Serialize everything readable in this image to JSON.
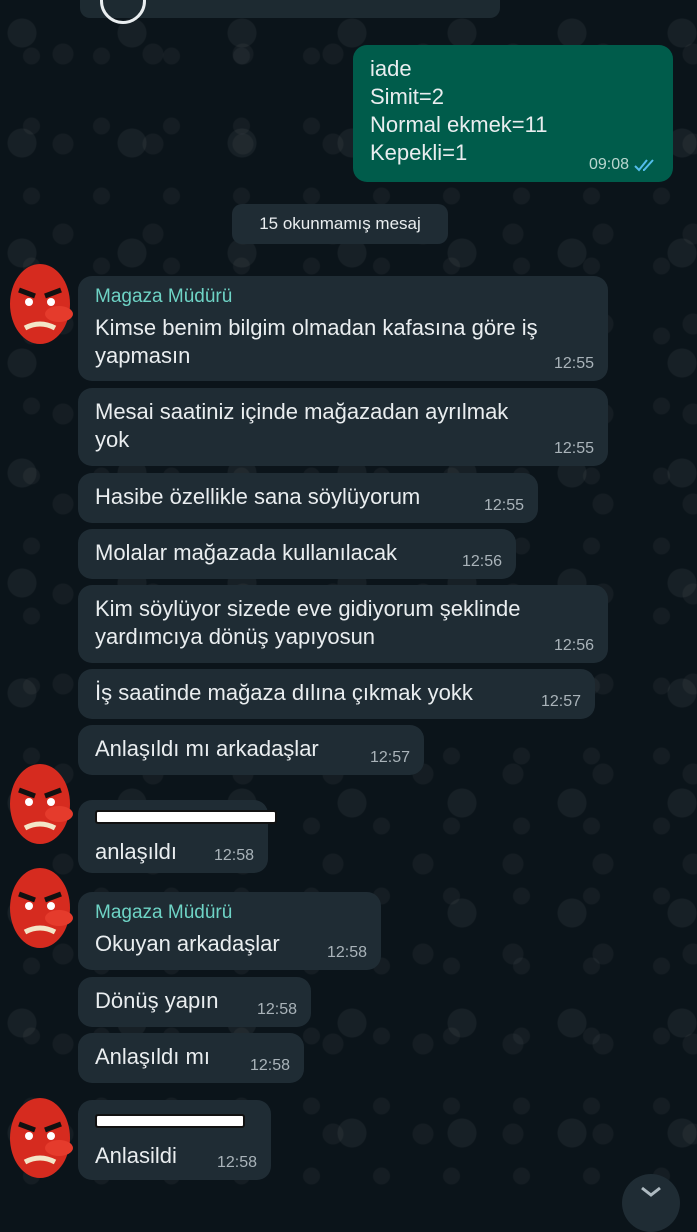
{
  "outgoing": {
    "text": "iade\nSimit=2\nNormal ekmek=11\nKepekli=1",
    "time": "09:08"
  },
  "unread_divider": "15 okunmamış mesaj",
  "sender_name": "Magaza Müdürü",
  "messages": [
    {
      "text": "Kimse benim bilgim olmadan kafasına göre iş\nyapmasın",
      "time": "12:55"
    },
    {
      "text": "Mesai saatiniz içinde mağazadan ayrılmak\nyok",
      "time": "12:55"
    },
    {
      "text": "Hasibe özellikle sana söylüyorum",
      "time": "12:55"
    },
    {
      "text": "Molalar mağazada kullanılacak",
      "time": "12:56"
    },
    {
      "text": "Kim söylüyor sizede eve gidiyorum şeklinde\nyardımcıya dönüş yapıyosun",
      "time": "12:56"
    },
    {
      "text": "İş saatinde mağaza dılına çıkmak yokk",
      "time": "12:57"
    },
    {
      "text": "Anlaşıldı mı arkadaşlar",
      "time": "12:57"
    },
    {
      "text": "anlaşıldı",
      "time": "12:58"
    },
    {
      "text": "Okuyan arkadaşlar",
      "time": "12:58"
    },
    {
      "text": "Dönüş yapın",
      "time": "12:58"
    },
    {
      "text": "Anlaşıldı mı",
      "time": "12:58"
    },
    {
      "text": "Anlasildi",
      "time": "12:58"
    }
  ],
  "colors": {
    "background": "#0b141a",
    "incoming_bubble": "#1f2c34",
    "outgoing_bubble": "#005c4b",
    "sender_name": "#6ed3c5",
    "read_ticks": "#53bdeb"
  },
  "icons": {
    "avatar": "red-tengu-mask-icon",
    "read_receipt": "double-check-icon"
  }
}
